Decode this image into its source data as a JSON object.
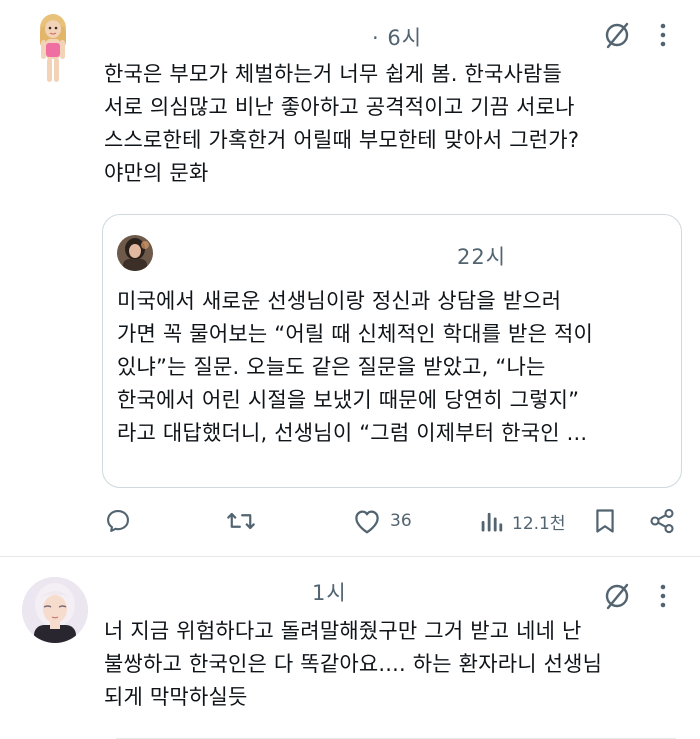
{
  "posts": [
    {
      "timestamp": "· 6시",
      "text": "한국은 부모가 체벌하는거 너무 쉽게 봄. 한국사람들\n서로 의심많고 비난 좋아하고 공격적이고 기끔 서로나\n스스로한테 가혹한거 어릴때 부모한테 맞아서 그런가?\n야만의 문화",
      "quote": {
        "timestamp": "22시",
        "text": "미국에서 새로운 선생님이랑 정신과 상담을 받으러\n가면 꼭 물어보는 “어릴 때 신체적인 학대를 받은 적이\n있냐”는 질문. 오늘도 같은 질문을 받았고, “나는\n한국에서 어린 시절을 보냈기 때문에 당연히 그렇지”\n라고 대답했더니, 선생님이 “그럼 이제부터 한국인 ..."
      },
      "actions": {
        "like_count": "36",
        "views_count": "12.1천"
      }
    },
    {
      "timestamp": "1시",
      "text": "너 지금 위험하다고 돌려말해줬구만 그거 받고 네네 난\n불쌍하고 한국인은 다 똑같아요.... 하는 환자라니 선생님\n되게 막막하실듯"
    }
  ],
  "icons": {
    "grok": "slashed-circle-icon",
    "more": "more-vertical-icon",
    "reply": "reply-icon",
    "repost": "repost-icon",
    "like": "heart-icon",
    "views": "views-icon",
    "bookmark": "bookmark-icon",
    "share": "share-icon"
  },
  "colors": {
    "text": "#0f1419",
    "muted": "#536471",
    "border": "#cfd9de"
  }
}
